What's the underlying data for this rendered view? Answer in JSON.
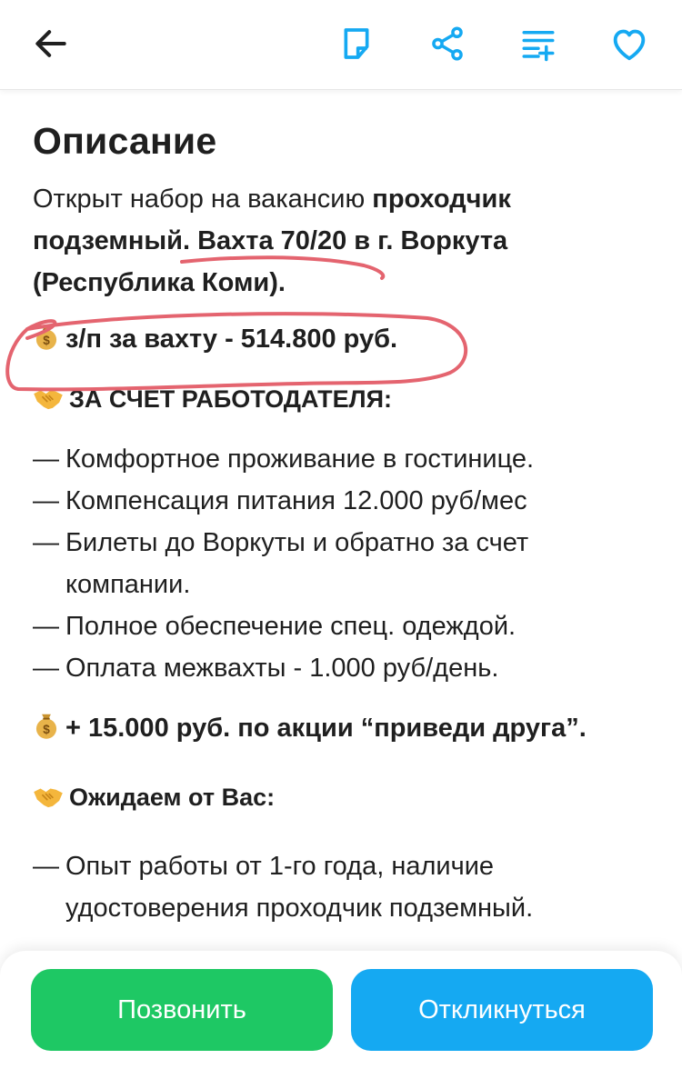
{
  "colors": {
    "accent": "#15a9f2",
    "call_button": "#1ec864",
    "apply_button": "#15a9f2",
    "annotation": "#e4646f"
  },
  "header": {
    "icons": [
      "arrow-left-icon",
      "note-icon",
      "share-icon",
      "compare-list-icon",
      "heart-icon"
    ]
  },
  "description": {
    "title": "Описание",
    "intro_plain_1": "Открыт набор на вакансию ",
    "intro_bold_1": "проходчик подземный",
    "intro_bold_2": ". Вахта 70/20 в г. Воркута (Республика Коми).",
    "salary": "з/п за вахту - 514.800 руб.",
    "employer_head": "ЗА СЧЁТ РАБОТОДАТЕЛЯ:",
    "employer_items": [
      "Комфортное проживание в гостинице.",
      "Компенсация питания 12.000 руб/мес",
      "Билеты до Воркуты и обратно за счет компании.",
      "Полное обеспечение спец. одеждой.",
      "Оплата межвахты - 1.000 руб/день."
    ],
    "promo": "+ 15.000 руб. по акции “приведи друга”.",
    "expect_head": "Ожидаем от Вас:",
    "expect_items": [
      "Опыт работы от 1-го года, наличие удостоверения проходчик подземный."
    ],
    "dash": "—"
  },
  "actions": {
    "call": "Позвонить",
    "apply": "Откликнуться"
  }
}
